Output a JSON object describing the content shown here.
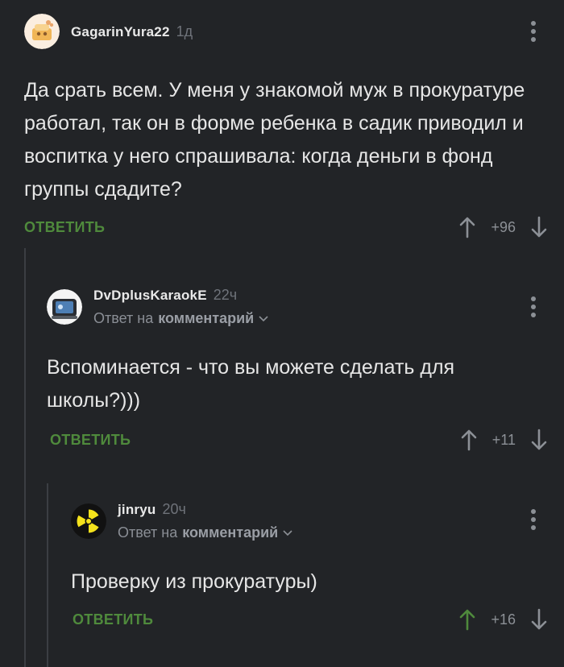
{
  "comments": [
    {
      "author": "GagarinYura22",
      "age": "1д",
      "text": "Да срать всем. У меня у знакомой муж в прокуратуре работал, так он в форме ребенка в садик приводил и воспитка у него спрашивала: когда деньги в фонд группы сдадите?",
      "reply_label": "ОТВЕТИТЬ",
      "rating": "+96"
    },
    {
      "author": "DvDplusKaraokE",
      "age": "22ч",
      "reply_prefix": "Ответ на",
      "reply_target": "комментарий",
      "text": "Вспоминается - что вы можете сделать для школы?)))",
      "reply_label": "ОТВЕТИТЬ",
      "rating": "+11"
    },
    {
      "author": "jinryu",
      "age": "20ч",
      "reply_prefix": "Ответ на",
      "reply_target": "комментарий",
      "text": "Проверку из прокуратуры)",
      "reply_label": "ОТВЕТИТЬ",
      "rating": "+16"
    }
  ],
  "colors": {
    "background": "#222427",
    "reply_green": "#4f8a3c",
    "muted": "#8c9096",
    "upvoted": "#4f8a3c"
  },
  "icons": [
    "avatar-image",
    "radiation-icon",
    "more-options-icon",
    "upvote-arrow-icon",
    "downvote-arrow-icon",
    "chevron-down-icon"
  ]
}
